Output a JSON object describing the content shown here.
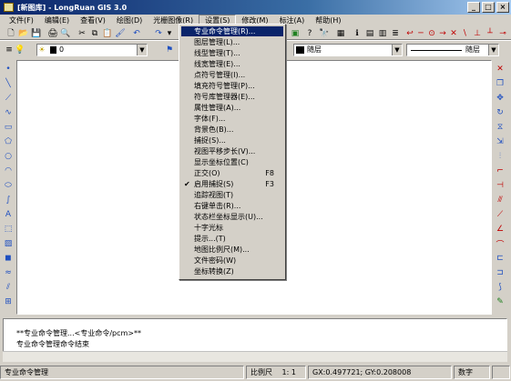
{
  "window": {
    "title": "[新图库] - LongRuan GIS 3.0",
    "min": "_",
    "max": "□",
    "close": "×"
  },
  "menubar": [
    {
      "label": "文件(F)"
    },
    {
      "label": "编辑(E)"
    },
    {
      "label": "查看(V)"
    },
    {
      "label": "绘图(D)"
    },
    {
      "label": "光栅图像(R)"
    },
    {
      "label": "设置(S)"
    },
    {
      "label": "修改(M)"
    },
    {
      "label": "标注(A)"
    },
    {
      "label": "帮助(H)"
    }
  ],
  "layer_combo": {
    "value": "0"
  },
  "color_combo": {
    "value": "随层"
  },
  "linetype_combo": {
    "value": "随层"
  },
  "settings_menu": [
    {
      "label": "专业命令管理(R)...",
      "shortcut": ""
    },
    {
      "label": "图层管理(L)...",
      "shortcut": ""
    },
    {
      "label": "线型管理(T)...",
      "shortcut": ""
    },
    {
      "label": "线宽管理(E)...",
      "shortcut": ""
    },
    {
      "label": "点符号管理(I)...",
      "shortcut": ""
    },
    {
      "label": "填充符号管理(P)...",
      "shortcut": ""
    },
    {
      "label": "符号库管理器(E)...",
      "shortcut": ""
    },
    {
      "label": "属性管理(A)...",
      "shortcut": ""
    },
    {
      "label": "字体(F)...",
      "shortcut": ""
    },
    {
      "label": "背景色(B)...",
      "shortcut": ""
    },
    {
      "label": "捕捉(S)...",
      "shortcut": ""
    },
    {
      "label": "视图平移步长(V)...",
      "shortcut": ""
    },
    {
      "label": "显示坐标位置(C)",
      "shortcut": ""
    },
    {
      "label": "正交(O)",
      "shortcut": "F8"
    },
    {
      "label": "启用捕捉(S)",
      "shortcut": "F3",
      "checked": "✔"
    },
    {
      "label": "追踪视图(T)",
      "shortcut": ""
    },
    {
      "label": "右键单击(R)...",
      "shortcut": ""
    },
    {
      "label": "状态栏坐标显示(U)...",
      "shortcut": ""
    },
    {
      "label": "十字光标",
      "shortcut": ""
    },
    {
      "label": "提示...(T)",
      "shortcut": ""
    },
    {
      "label": "地图比例尺(M)...",
      "shortcut": ""
    },
    {
      "label": "文件密码(W)",
      "shortcut": ""
    },
    {
      "label": "坐标转换(Z)",
      "shortcut": ""
    }
  ],
  "command_area": {
    "line1": "**专业命令管理...<专业命令/pcm>**",
    "line2": "专业命令管理命令结束"
  },
  "statusbar": {
    "message": "专业命令管理",
    "scale_label": "比例尺",
    "scale_value": "1: 1",
    "coords": "GX:0.497721; GY:0.208008",
    "mode": "数字"
  },
  "colors": {
    "highlight": "#0a246a",
    "titlebar": "#0a246a",
    "face": "#d4d0c8"
  }
}
